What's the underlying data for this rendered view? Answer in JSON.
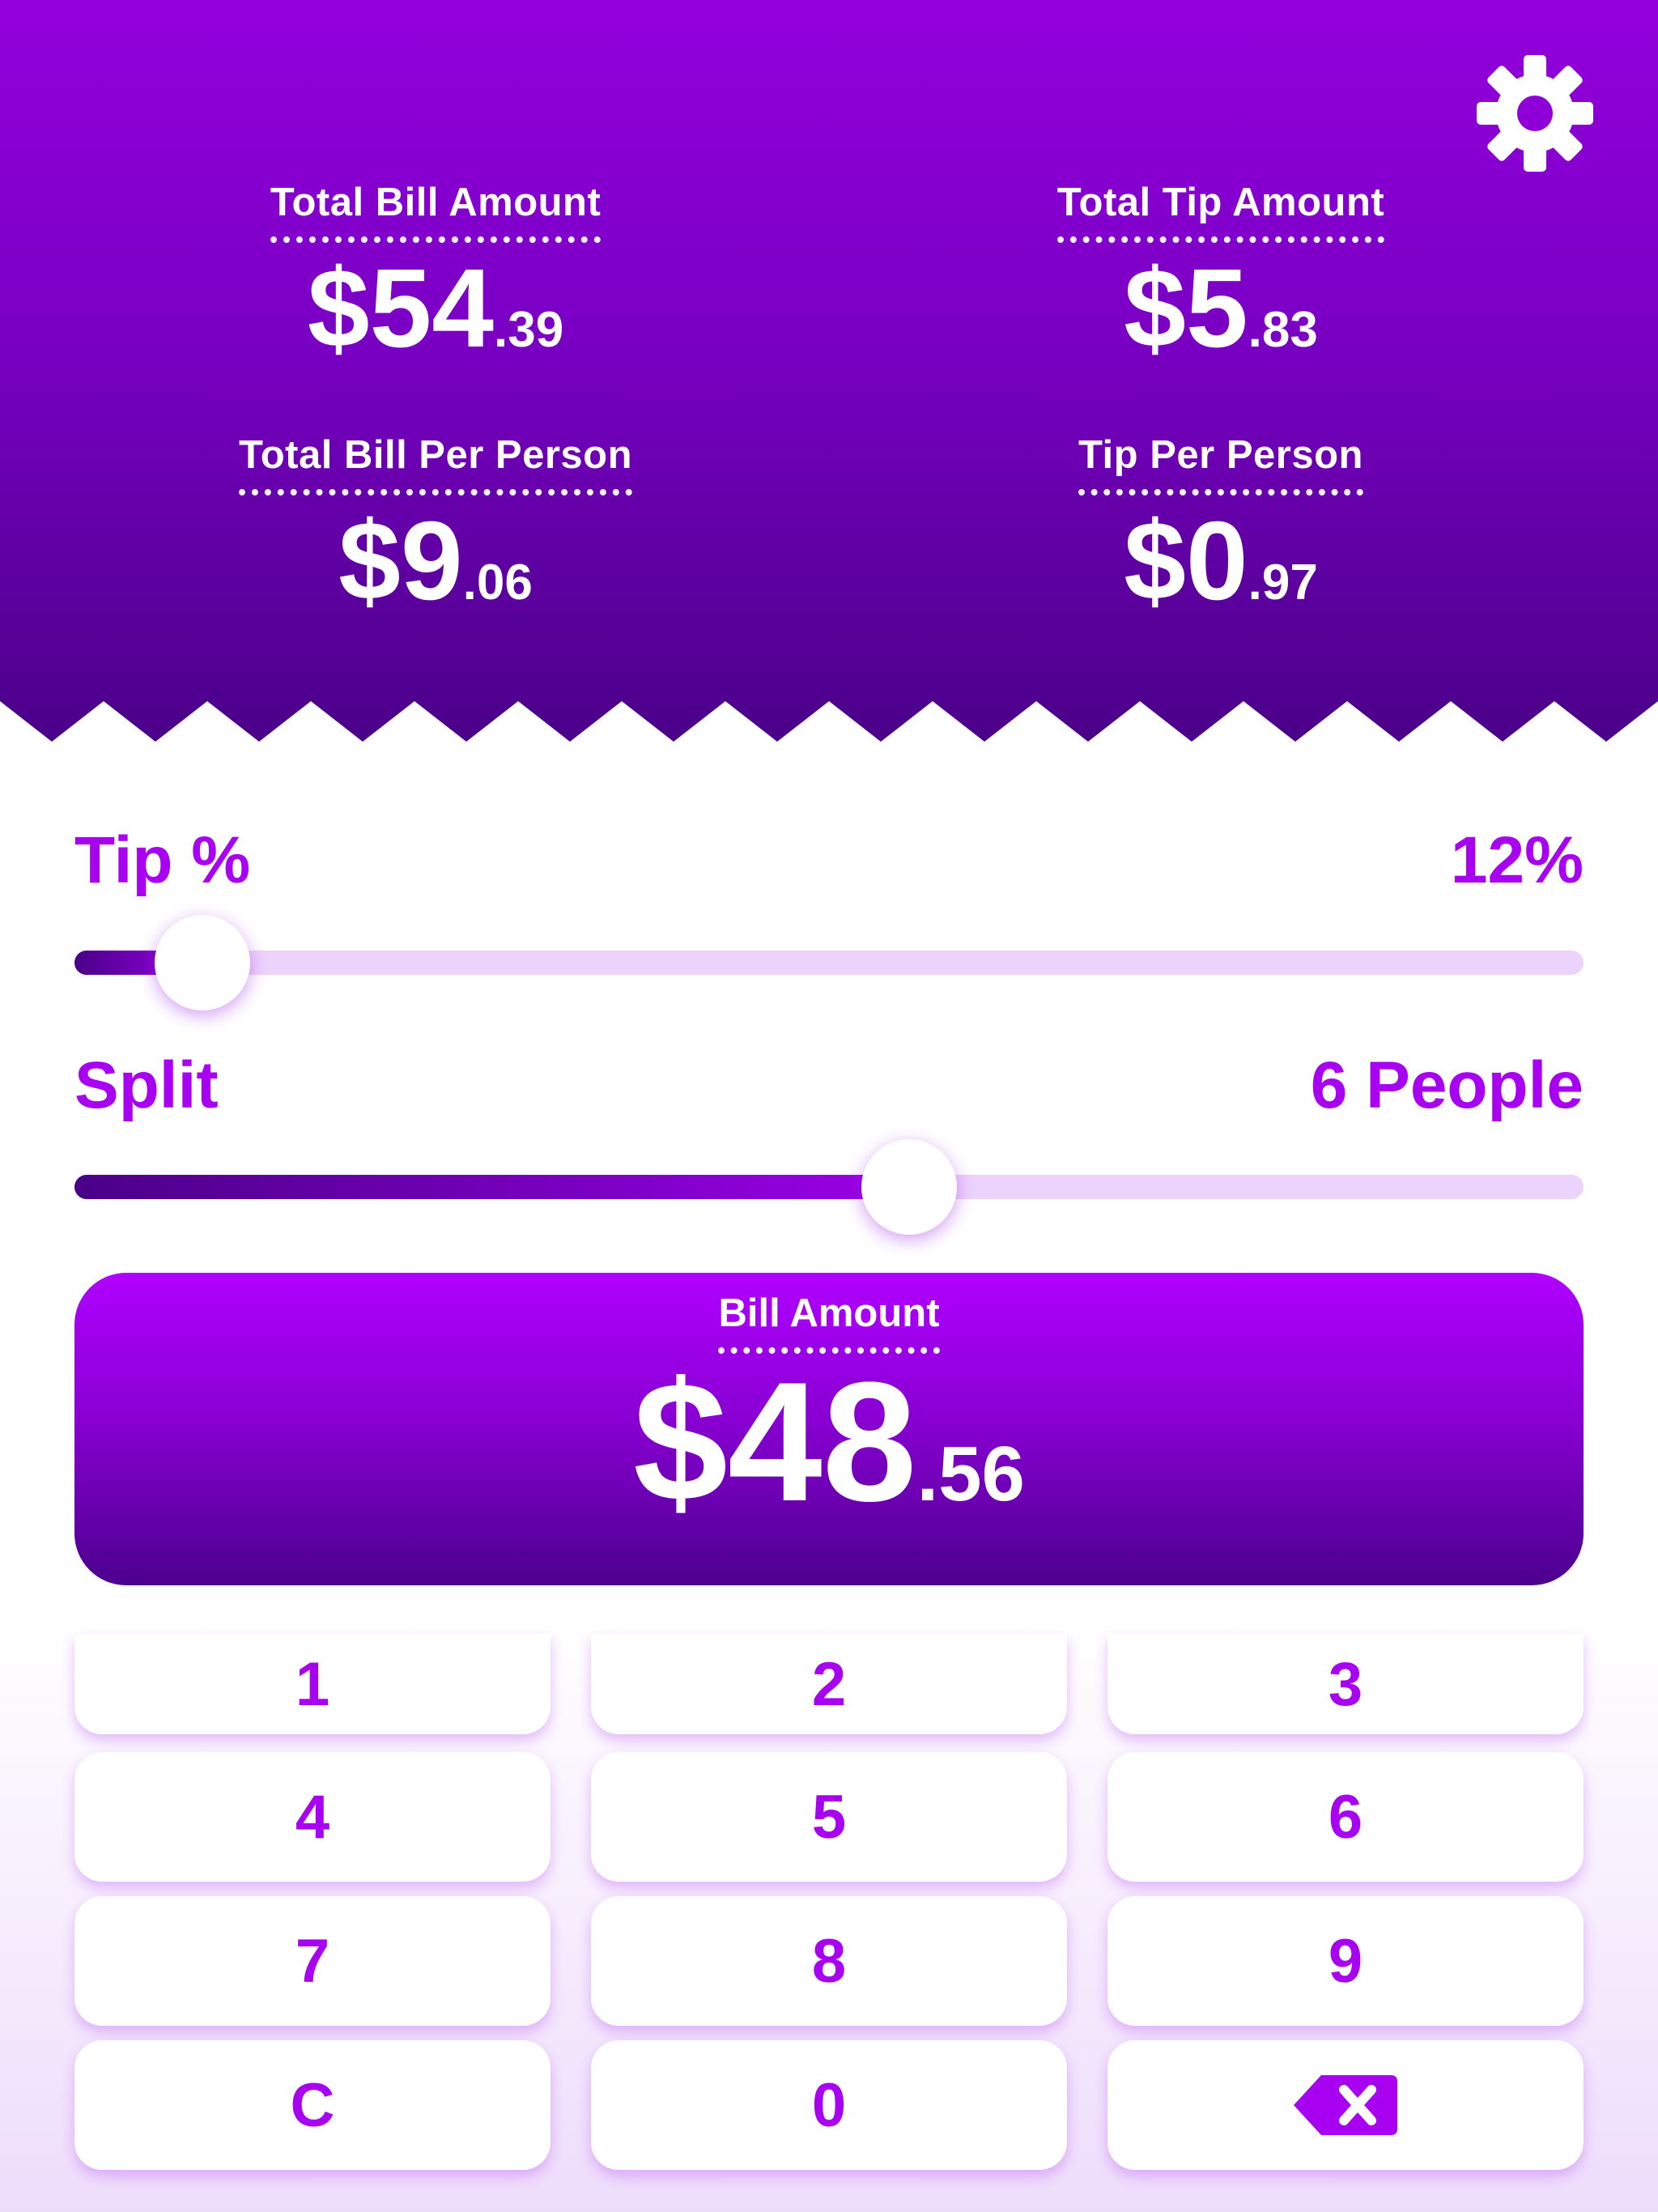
{
  "colors": {
    "accent": "#a800f0",
    "header_top": "#9300dc",
    "header_bottom": "#4a0088",
    "track": "#ecd3fb"
  },
  "header": {
    "settings_icon": "gear-icon",
    "total_bill": {
      "label": "Total Bill Amount",
      "dollars": "$54",
      "cents": ".39"
    },
    "total_tip": {
      "label": "Total Tip Amount",
      "dollars": "$5",
      "cents": ".83"
    },
    "bill_per_person": {
      "label": "Total Bill Per Person",
      "dollars": "$9",
      "cents": ".06"
    },
    "tip_per_person": {
      "label": "Tip Per Person",
      "dollars": "$0",
      "cents": ".97"
    }
  },
  "tip": {
    "label": "Tip %",
    "value_text": "12%",
    "fraction": 0.085
  },
  "split": {
    "label": "Split",
    "value_text": "6 People",
    "fraction": 0.553
  },
  "bill": {
    "label": "Bill Amount",
    "dollars": "$48",
    "cents": ".56"
  },
  "keypad": {
    "keys": [
      "1",
      "2",
      "3",
      "4",
      "5",
      "6",
      "7",
      "8",
      "9",
      "C",
      "0"
    ],
    "backspace_icon": "backspace-icon"
  }
}
